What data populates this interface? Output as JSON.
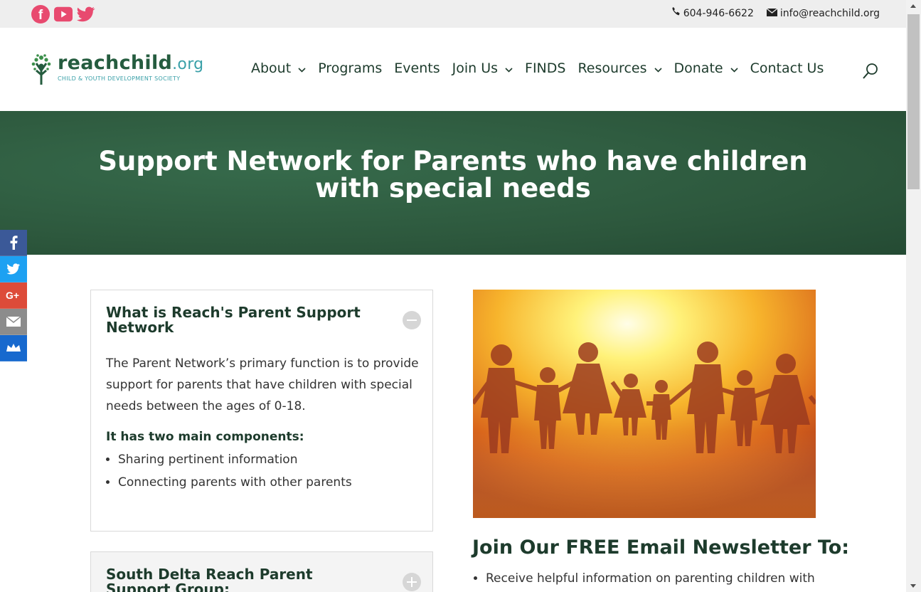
{
  "topbar": {
    "social": [
      "facebook-icon",
      "youtube-icon",
      "twitter-icon"
    ],
    "phone": "604-946-6622",
    "email": "info@reachchild.org"
  },
  "logo": {
    "main": "reachchild",
    "org": ".org",
    "sub": "CHILD & YOUTH DEVELOPMENT SOCIETY"
  },
  "nav": {
    "items": [
      {
        "label": "About",
        "dropdown": true
      },
      {
        "label": "Programs",
        "dropdown": false
      },
      {
        "label": "Events",
        "dropdown": false
      },
      {
        "label": "Join Us",
        "dropdown": true
      },
      {
        "label": "FINDS",
        "dropdown": false
      },
      {
        "label": "Resources",
        "dropdown": true
      },
      {
        "label": "Donate",
        "dropdown": true
      },
      {
        "label": "Contact Us",
        "dropdown": false
      }
    ]
  },
  "hero": {
    "title": "Support Network for Parents who have children with special needs"
  },
  "share": [
    "f",
    "twitter",
    "G+",
    "email",
    "crown"
  ],
  "accordion": [
    {
      "title": "What is Reach's Parent Support Network",
      "open": true,
      "paragraph": "The Parent Network’s primary function is to provide support for parents that have children with special needs between the ages of 0-18.",
      "subheading": "It has two main components:",
      "bullets": [
        "Sharing pertinent information",
        "Connecting parents with other parents"
      ]
    },
    {
      "title": "South Delta Reach Parent Support Group:",
      "open": false
    }
  ],
  "newsletter": {
    "heading": "Join Our FREE Email Newsletter To:",
    "bullets": [
      "Receive helpful information on parenting children with"
    ]
  },
  "colors": {
    "brand_green": "#1d3b2c",
    "hero_green": "#2e5a3f",
    "accent_teal": "#3aa0a8",
    "social_pink": "#e84a6f"
  }
}
